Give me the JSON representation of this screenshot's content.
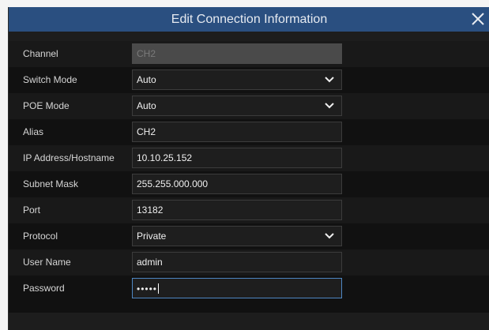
{
  "dialog": {
    "title": "Edit Connection Information"
  },
  "fields": [
    {
      "label": "Channel",
      "value": "CH2",
      "type": "disabled"
    },
    {
      "label": "Switch Mode",
      "value": "Auto",
      "type": "select"
    },
    {
      "label": "POE Mode",
      "value": "Auto",
      "type": "select"
    },
    {
      "label": "Alias",
      "value": "CH2",
      "type": "text"
    },
    {
      "label": "IP Address/Hostname",
      "value": "10.10.25.152",
      "type": "text"
    },
    {
      "label": "Subnet Mask",
      "value": "255.255.000.000",
      "type": "text"
    },
    {
      "label": "Port",
      "value": "13182",
      "type": "text"
    },
    {
      "label": "Protocol",
      "value": "Private",
      "type": "select"
    },
    {
      "label": "User Name",
      "value": "admin",
      "type": "text"
    },
    {
      "label": "Password",
      "value": "•••••",
      "type": "password"
    }
  ],
  "icons": {
    "close": "close-icon",
    "dropdown": "chevron-down-icon"
  },
  "colors": {
    "titlebar": "#2a4f80",
    "focus": "#4e86c2"
  }
}
